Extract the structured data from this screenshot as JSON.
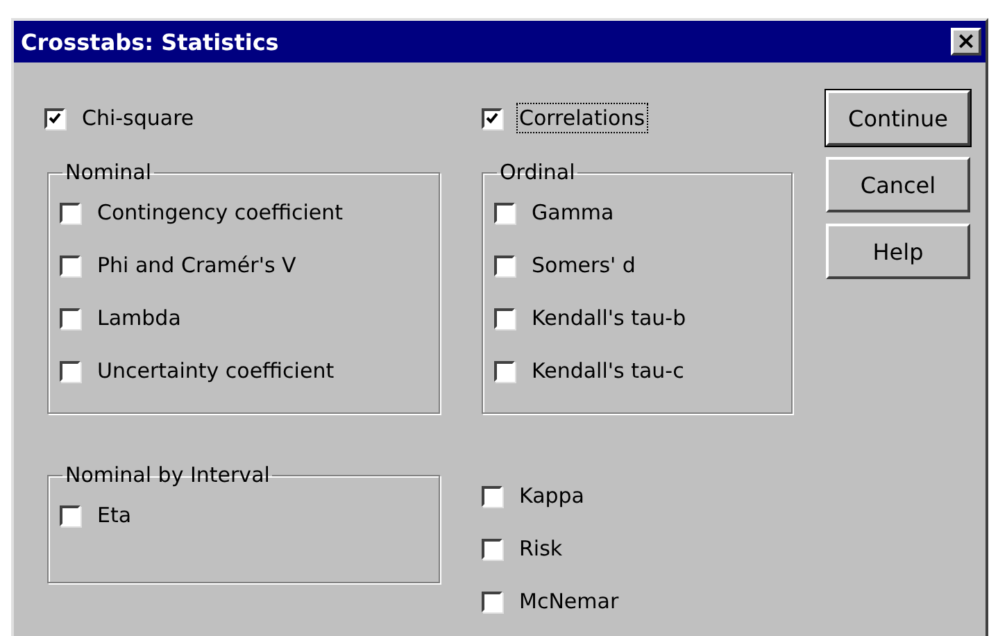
{
  "window": {
    "title": "Crosstabs: Statistics",
    "close": "×"
  },
  "top_options": [
    {
      "label": "Chi-square",
      "checked": true,
      "focused": false
    },
    {
      "label": "Correlations",
      "checked": true,
      "focused": true
    }
  ],
  "groups": [
    {
      "title": "Nominal",
      "items": [
        {
          "label": "Contingency coefficient",
          "checked": false
        },
        {
          "label": "Phi and Cramér's V",
          "checked": false
        },
        {
          "label": "Lambda",
          "checked": false
        },
        {
          "label": "Uncertainty coefficient",
          "checked": false
        }
      ]
    },
    {
      "title": "Ordinal",
      "items": [
        {
          "label": "Gamma",
          "checked": false
        },
        {
          "label": "Somers' d",
          "checked": false
        },
        {
          "label": "Kendall's tau-b",
          "checked": false
        },
        {
          "label": "Kendall's tau-c",
          "checked": false
        }
      ]
    }
  ],
  "interval_group": {
    "title": "Nominal by Interval",
    "items": [
      {
        "label": "Eta",
        "checked": false
      }
    ]
  },
  "other_options": [
    {
      "label": "Kappa",
      "checked": false
    },
    {
      "label": "Risk",
      "checked": false
    },
    {
      "label": "McNemar",
      "checked": false
    }
  ],
  "buttons": [
    {
      "label": "Continue",
      "default": true
    },
    {
      "label": "Cancel",
      "default": false
    },
    {
      "label": "Help",
      "default": false
    }
  ]
}
